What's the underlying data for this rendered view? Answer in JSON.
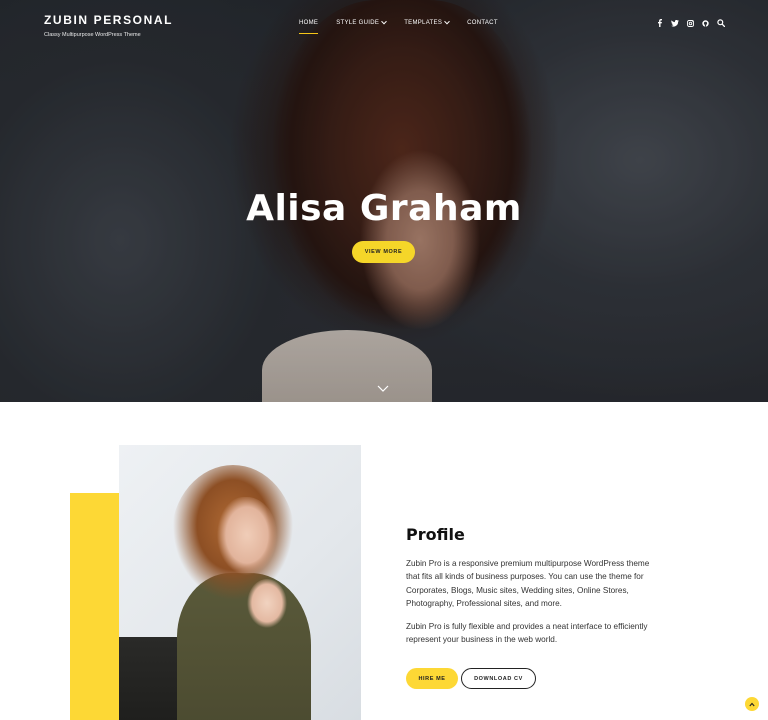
{
  "brand": {
    "title": "ZUBIN PERSONAL",
    "tagline": "Classy Multipurpose WordPress Theme"
  },
  "nav": {
    "items": [
      {
        "label": "HOME",
        "active": true
      },
      {
        "label": "STYLE GUIDE",
        "dropdown": true
      },
      {
        "label": "TEMPLATES",
        "dropdown": true
      },
      {
        "label": "CONTACT"
      }
    ]
  },
  "social": {
    "icons": [
      "facebook-icon",
      "twitter-icon",
      "instagram-icon",
      "github-icon",
      "search-icon"
    ]
  },
  "hero": {
    "title": "Alisa Graham",
    "button_label": "VIEW MORE",
    "scroll_icon": "chevron-down-icon"
  },
  "profile": {
    "title": "Profile",
    "paragraph1": "Zubin Pro is a responsive premium multipurpose WordPress theme that fits all kinds of business purposes. You can use the theme for Corporates, Blogs, Music sites, Wedding sites, Online Stores, Photography, Professional sites, and more.",
    "paragraph2": "Zubin Pro is fully flexible and provides a neat interface to efficiently represent your business in the web world.",
    "hire_label": "HIRE ME",
    "cv_label": "DOWNLOAD CV"
  },
  "colors": {
    "accent": "#fdd835",
    "dark": "#222222"
  }
}
